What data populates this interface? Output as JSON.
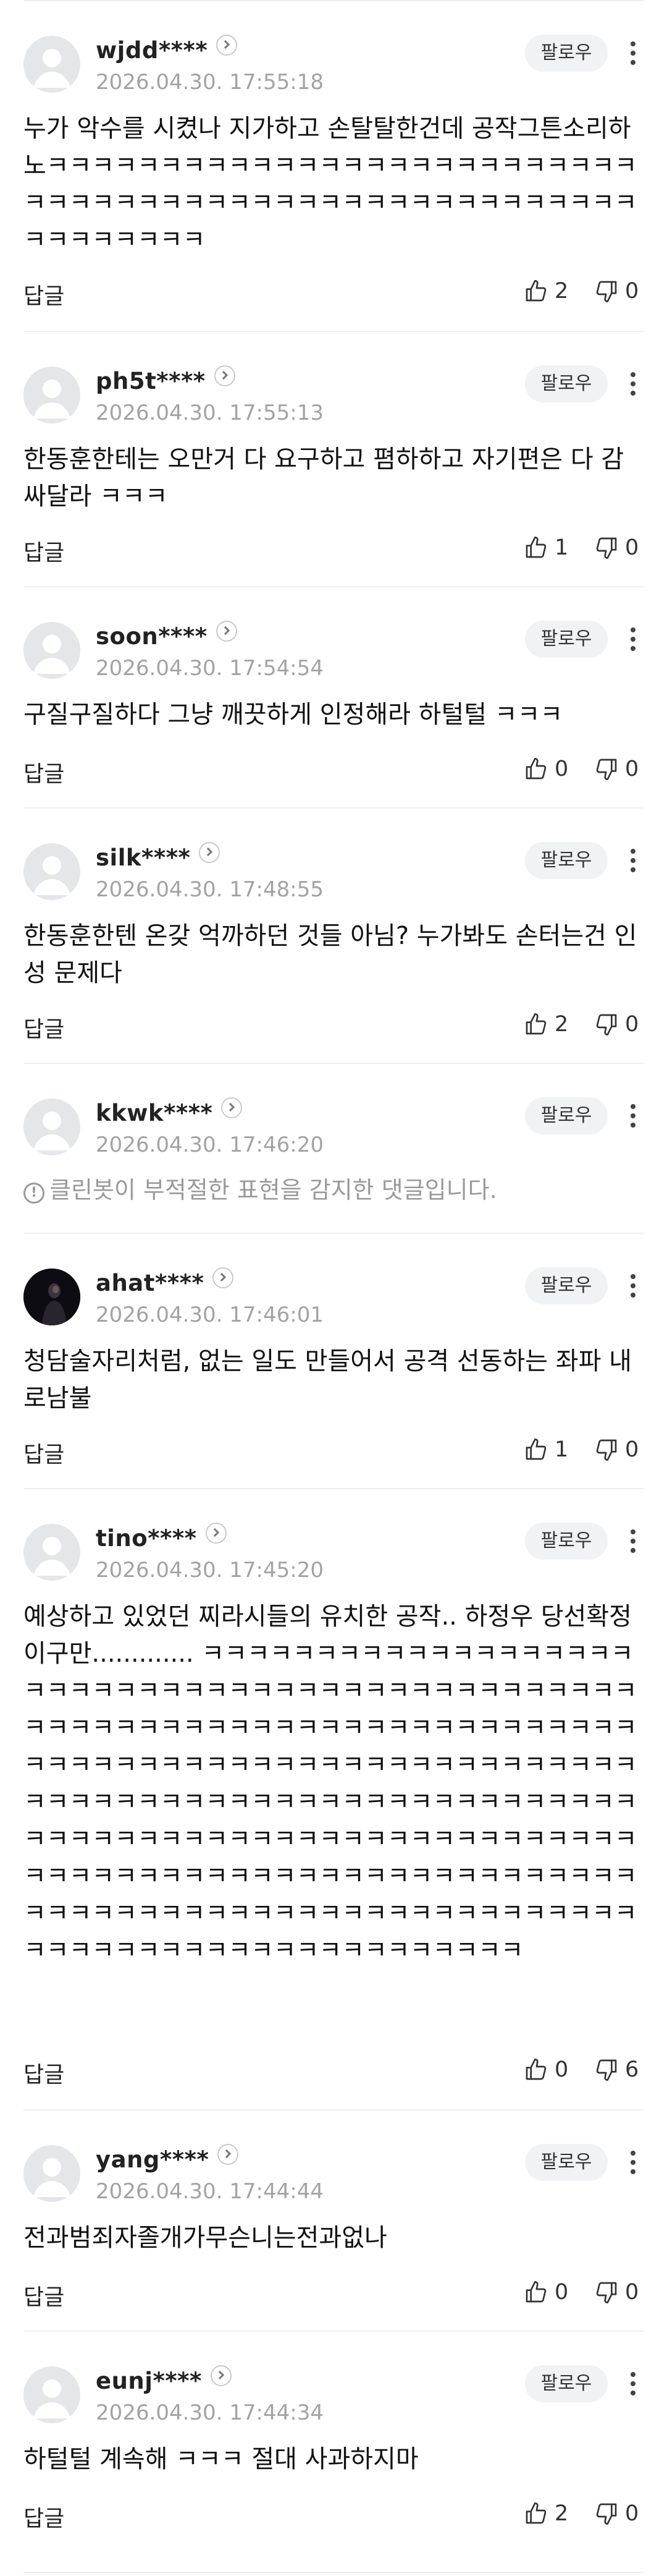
{
  "labels": {
    "follow": "팔로우",
    "reply": "답글"
  },
  "comments": [
    {
      "username": "wjdd****",
      "timestamp": "2026.04.30. 17:55:18",
      "text": "누가 악수를 시켰나 지가하고 손탈탈한건데 공작그튼소리하노ㅋㅋㅋㅋㅋㅋㅋㅋㅋㅋㅋㅋㅋㅋㅋㅋㅋㅋㅋㅋㅋㅋㅋㅋㅋㅋㅋㅋㅋㅋㅋㅋㅋㅋㅋㅋㅋㅋㅋㅋㅋㅋㅋㅋㅋㅋㅋㅋㅋㅋㅋㅋㅋㅋㅋㅋㅋㅋㅋㅋㅋ",
      "likes": "2",
      "dislikes": "0"
    },
    {
      "username": "ph5t****",
      "timestamp": "2026.04.30. 17:55:13",
      "text": "한동훈한테는 오만거 다 요구하고 폄하하고 자기편은 다 감싸달라 ㅋㅋㅋ",
      "likes": "1",
      "dislikes": "0"
    },
    {
      "username": "soon****",
      "timestamp": "2026.04.30. 17:54:54",
      "text": "구질구질하다 그냥 깨끗하게 인정해라 하털털 ㅋㅋㅋ",
      "likes": "0",
      "dislikes": "0"
    },
    {
      "username": "silk****",
      "timestamp": "2026.04.30. 17:48:55",
      "text": "한동훈한텐 온갖 억까하던 것들 아님? 누가봐도 손터는건 인성 문제다",
      "likes": "2",
      "dislikes": "0"
    },
    {
      "username": "kkwk****",
      "timestamp": "2026.04.30. 17:46:20",
      "notice_brand": "클린봇",
      "notice_rest": "이 부적절한 표현을 감지한 댓글입니다."
    },
    {
      "username": "ahat****",
      "timestamp": "2026.04.30. 17:46:01",
      "text": "청담술자리처럼, 없는 일도 만들어서 공격 선동하는 좌파 내로남불",
      "likes": "1",
      "dislikes": "0"
    },
    {
      "username": "tino****",
      "timestamp": "2026.04.30. 17:45:20",
      "text": "예상하고 있었던 찌라시들의 유치한 공작.. 하정우 당선확정이구만............. ㅋㅋㅋㅋㅋㅋㅋㅋㅋㅋㅋㅋㅋㅋㅋㅋㅋㅋㅋㅋㅋㅋㅋㅋㅋㅋㅋㅋㅋㅋㅋㅋㅋㅋㅋㅋㅋㅋㅋㅋㅋㅋㅋㅋㅋㅋㅋㅋㅋㅋㅋㅋㅋㅋㅋㅋㅋㅋㅋㅋㅋㅋㅋㅋㅋㅋㅋㅋㅋㅋㅋㅋㅋㅋㅋㅋㅋㅋㅋㅋㅋㅋㅋㅋㅋㅋㅋㅋㅋㅋㅋㅋㅋㅋㅋㅋㅋㅋㅋㅋㅋㅋㅋㅋㅋㅋㅋㅋㅋㅋㅋㅋㅋㅋㅋㅋㅋㅋㅋㅋㅋㅋㅋㅋㅋㅋㅋㅋㅋㅋㅋㅋㅋㅋㅋㅋㅋㅋㅋㅋㅋㅋㅋㅋㅋㅋㅋㅋㅋㅋㅋㅋㅋㅋㅋㅋㅋㅋㅋㅋㅋㅋㅋㅋㅋㅋㅋㅋㅋㅋㅋㅋㅋㅋㅋㅋㅋㅋㅋㅋㅋㅋㅋㅋㅋㅋㅋㅋㅋㅋㅋㅋㅋㅋㅋㅋㅋㅋㅋㅋㅋㅋㅋㅋㅋㅋㅋㅋㅋㅋㅋㅋㅋㅋㅋㅋㅋㅋㅋㅋㅋㅋㅋㅋㅋㅋㅋㅋㅋㅋ",
      "likes": "0",
      "dislikes": "6"
    },
    {
      "username": "yang****",
      "timestamp": "2026.04.30. 17:44:44",
      "text": "전과범죄자졸개가무슨니는전과없나",
      "likes": "0",
      "dislikes": "0"
    },
    {
      "username": "eunj****",
      "timestamp": "2026.04.30. 17:44:34",
      "text": "하털털 계속해 ㅋㅋㅋ 절대 사과하지마",
      "likes": "2",
      "dislikes": "0"
    }
  ]
}
